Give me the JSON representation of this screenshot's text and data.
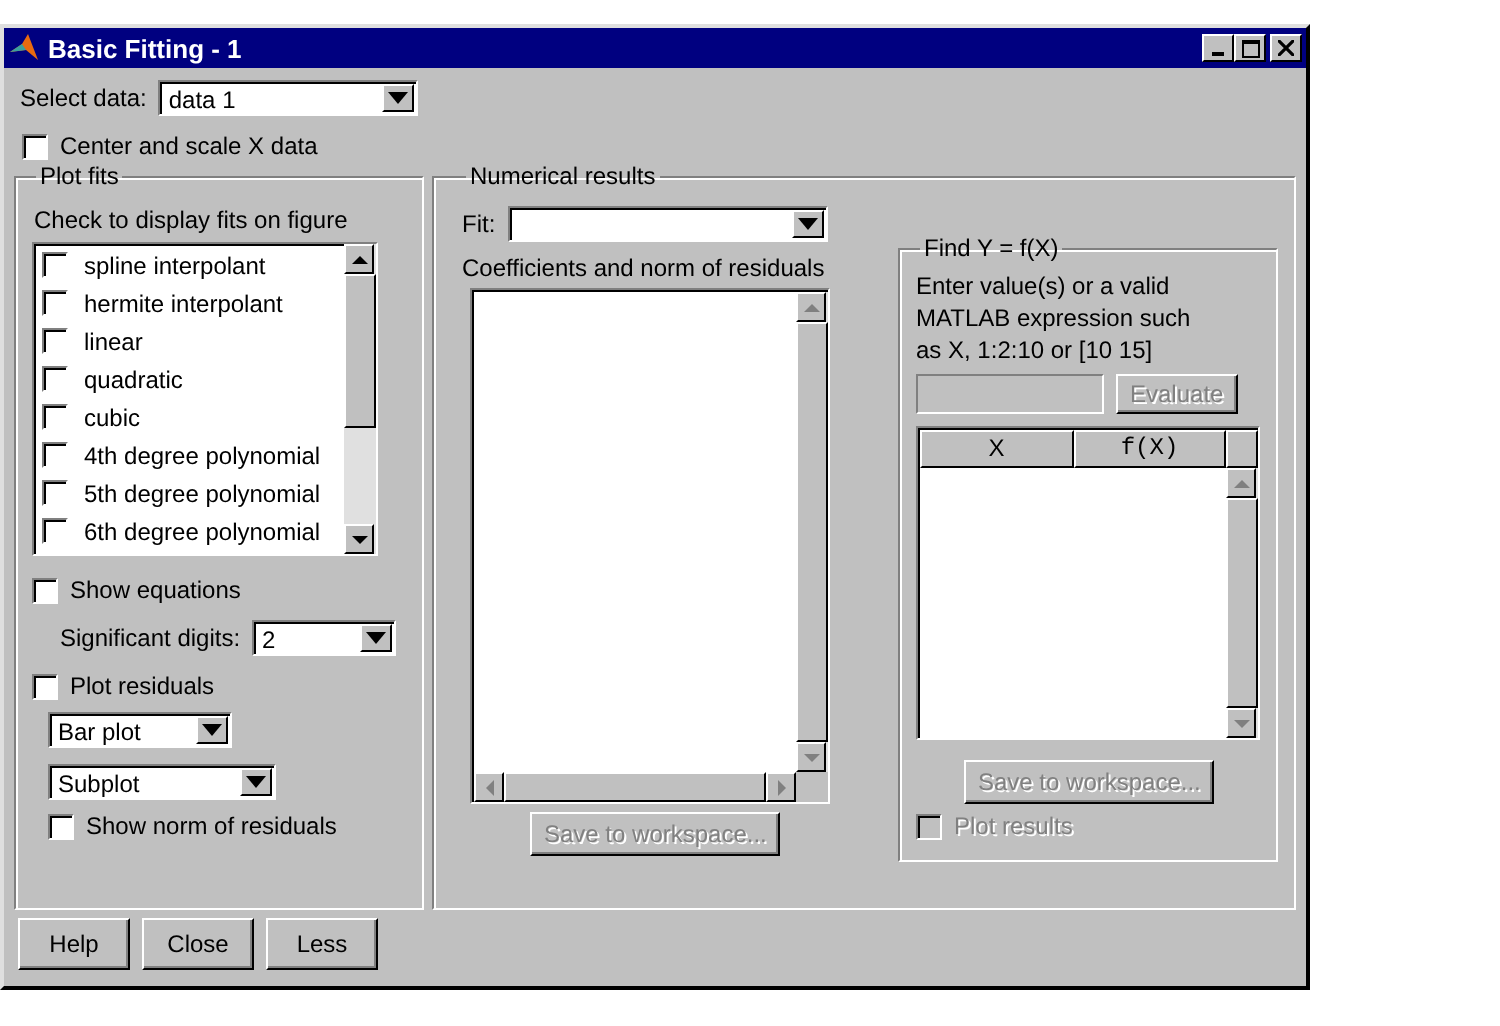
{
  "window": {
    "title": "Basic Fitting - 1"
  },
  "select_data": {
    "label": "Select data:",
    "value": "data 1"
  },
  "center_scale": {
    "label": "Center and scale X data",
    "checked": false
  },
  "plot_fits": {
    "title": "Plot fits",
    "instruction": "Check to display fits on figure",
    "fits": [
      {
        "label": "spline interpolant",
        "checked": false
      },
      {
        "label": "hermite interpolant",
        "checked": false
      },
      {
        "label": "linear",
        "checked": false
      },
      {
        "label": "quadratic",
        "checked": false
      },
      {
        "label": "cubic",
        "checked": false
      },
      {
        "label": "4th degree polynomial",
        "checked": false
      },
      {
        "label": "5th degree polynomial",
        "checked": false
      },
      {
        "label": "6th degree polynomial",
        "checked": false
      }
    ],
    "show_equations": {
      "label": "Show equations",
      "checked": false
    },
    "significant_digits": {
      "label": "Significant digits:",
      "value": "2"
    },
    "plot_residuals": {
      "label": "Plot residuals",
      "checked": false
    },
    "residual_plot_type": {
      "value": "Bar plot"
    },
    "residual_layout": {
      "value": "Subplot"
    },
    "show_norm": {
      "label": "Show norm of residuals",
      "checked": false
    }
  },
  "numerical_results": {
    "title": "Numerical results",
    "fit": {
      "label": "Fit:"
    },
    "coefficients_label": "Coefficients and norm of residuals",
    "save_button": {
      "label": "Save to workspace...",
      "disabled": true
    },
    "find_y": {
      "title": "Find Y = f(X)",
      "instruction": "Enter value(s) or a valid MATLAB expression such as X, 1:2:10 or [10 15]",
      "evaluate_button": {
        "label": "Evaluate",
        "disabled": true
      },
      "table": {
        "columns": [
          "X",
          "f(X)"
        ]
      },
      "save_button": {
        "label": "Save to workspace...",
        "disabled": true
      },
      "plot_results": {
        "label": "Plot results",
        "checked": false,
        "disabled": true
      }
    }
  },
  "buttons": [
    {
      "label": "Help"
    },
    {
      "label": "Close"
    },
    {
      "label": "Less"
    }
  ]
}
